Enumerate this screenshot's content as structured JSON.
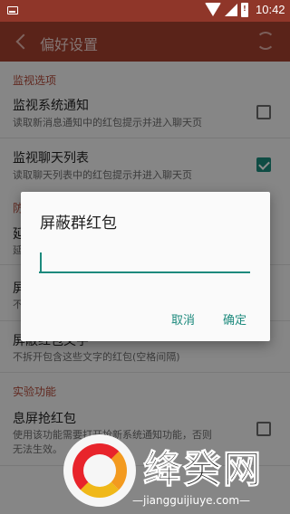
{
  "status_bar": {
    "time": "10:42",
    "battery_glyph": "!"
  },
  "toolbar": {
    "title": "偏好设置"
  },
  "sections": [
    {
      "header": "监视选项"
    },
    {
      "header": "防"
    },
    {
      "header": "实验功能"
    }
  ],
  "items": {
    "notify": {
      "title": "监视系统通知",
      "subtitle": "读取新消息通知中的红包提示并进入聊天页",
      "checked": false
    },
    "chatlist": {
      "title": "监视聊天列表",
      "subtitle": "读取聊天列表中的红包提示并进入聊天页",
      "checked": true
    },
    "partial_a_title": "延",
    "partial_a_sub": "延",
    "partial_b_title": "屏",
    "partial_b_sub": "不",
    "words": {
      "title": "屏蔽红包文字",
      "subtitle": "不拆开包含这些文字的红包(空格间隔)"
    },
    "screen_off": {
      "title": "息屏抢红包",
      "subtitle_line1": "使用该功能需要打开抢新系统通知功能，否则",
      "subtitle_line2": "无法生效。"
    }
  },
  "dialog": {
    "title": "屏蔽群红包",
    "input_value": "",
    "cancel": "取消",
    "confirm": "确定"
  },
  "watermark": {
    "brand": "绛癸网",
    "url": "—jiangguijiuye.com—"
  },
  "colors": {
    "primary": "#a4402f",
    "status_bar": "#8f3629",
    "accent": "#1d8a7d"
  }
}
